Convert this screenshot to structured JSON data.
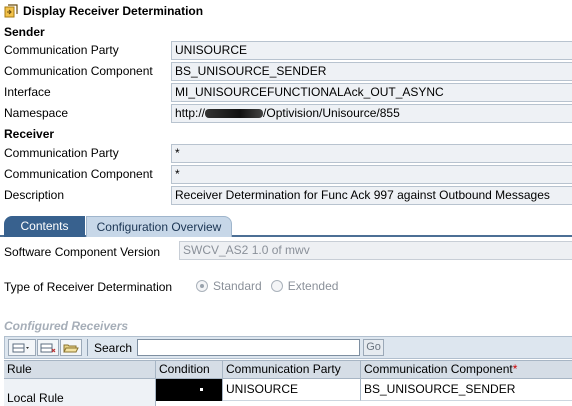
{
  "window": {
    "title": "Display Receiver Determination"
  },
  "sender": {
    "heading": "Sender",
    "fields": [
      {
        "label": "Communication Party",
        "value": "UNISOURCE"
      },
      {
        "label": "Communication Component",
        "value": "BS_UNISOURCE_SENDER"
      },
      {
        "label": "Interface",
        "value": "MI_UNISOURCEFUNCTIONALAck_OUT_ASYNC"
      },
      {
        "label": "Namespace",
        "value_prefix": "http://",
        "value_suffix": "/Optivision/Unisource/855"
      }
    ]
  },
  "receiver": {
    "heading": "Receiver",
    "fields": [
      {
        "label": "Communication Party",
        "value": "*"
      },
      {
        "label": "Communication Component",
        "value": "*"
      },
      {
        "label": "Description",
        "value": "Receiver Determination for Func Ack 997 against Outbound Messages"
      }
    ]
  },
  "tabs": [
    {
      "label": "Contents",
      "active": true
    },
    {
      "label": "Configuration Overview",
      "active": false
    }
  ],
  "contents": {
    "scv_label": "Software Component Version",
    "scv_value": "SWCV_AS2 1.0 of mwv",
    "trd_label": "Type of Receiver Determination",
    "trd_options": [
      {
        "label": "Standard",
        "selected": true
      },
      {
        "label": "Extended",
        "selected": false
      }
    ],
    "configured_receivers_heading": "Configured Receivers"
  },
  "toolbar": {
    "search_label": "Search",
    "search_value": "",
    "go_label": "Go",
    "icons": [
      "insert-row-icon",
      "delete-row-icon",
      "open-folder-icon"
    ]
  },
  "grid": {
    "columns": [
      {
        "label": "Rule",
        "required": false
      },
      {
        "label": "Condition",
        "required": false
      },
      {
        "label": "Communication Party",
        "required": false
      },
      {
        "label": "Communication Component",
        "required": true
      }
    ],
    "rows": [
      {
        "rule": "Local Rule",
        "condition": "",
        "party": "UNISOURCE",
        "component": "BS_UNISOURCE_SENDER"
      }
    ]
  },
  "colors": {
    "tab_active": "#38618e",
    "tab_inactive": "#c7d7e8",
    "field_bg": "#eef1f5",
    "required_marker": "#cc0000"
  }
}
